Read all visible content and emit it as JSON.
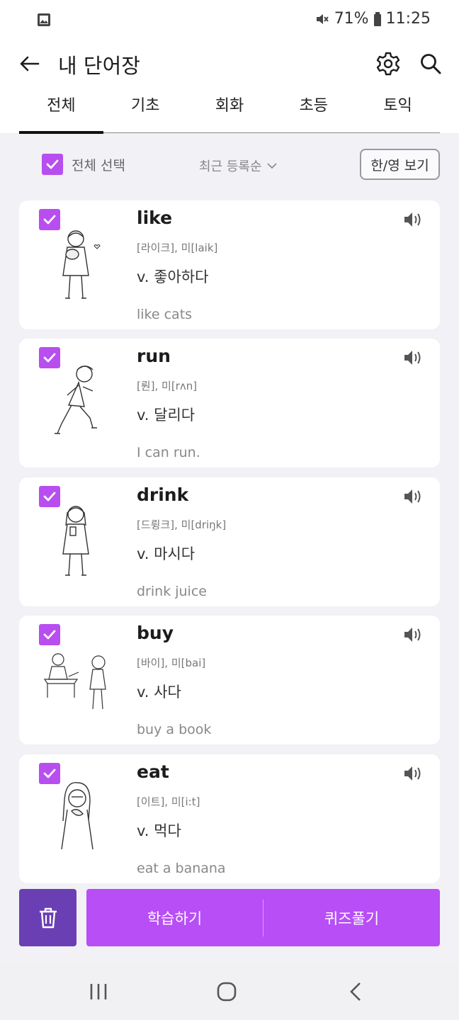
{
  "status_bar": {
    "battery": "71%",
    "time": "11:25"
  },
  "header": {
    "title": "내 단어장"
  },
  "tabs": [
    {
      "label": "전체",
      "active": true
    },
    {
      "label": "기초",
      "active": false
    },
    {
      "label": "회화",
      "active": false
    },
    {
      "label": "초등",
      "active": false
    },
    {
      "label": "토익",
      "active": false
    }
  ],
  "controls": {
    "select_all": "전체 선택",
    "sort": "최근 등록순",
    "lang_toggle": "한/영 보기"
  },
  "words": [
    {
      "word": "like",
      "pronunciation": "[라이크], 미[laik]",
      "meaning": "v. 좋아하다",
      "example": "like cats"
    },
    {
      "word": "run",
      "pronunciation": "[뤈], 미[rʌn]",
      "meaning": "v. 달리다",
      "example": "I can run."
    },
    {
      "word": "drink",
      "pronunciation": "[드륑크], 미[driŋk]",
      "meaning": "v. 마시다",
      "example": "drink juice"
    },
    {
      "word": "buy",
      "pronunciation": "[바이], 미[bai]",
      "meaning": "v. 사다",
      "example": "buy a book"
    },
    {
      "word": "eat",
      "pronunciation": "[이트], 미[i:t]",
      "meaning": "v. 먹다",
      "example": "eat a banana"
    }
  ],
  "actions": {
    "study": "학습하기",
    "quiz": "퀴즈풀기"
  },
  "colors": {
    "accent": "#b84ef6",
    "trash": "#6b3fb4",
    "checkbox": "#b84ef0"
  }
}
